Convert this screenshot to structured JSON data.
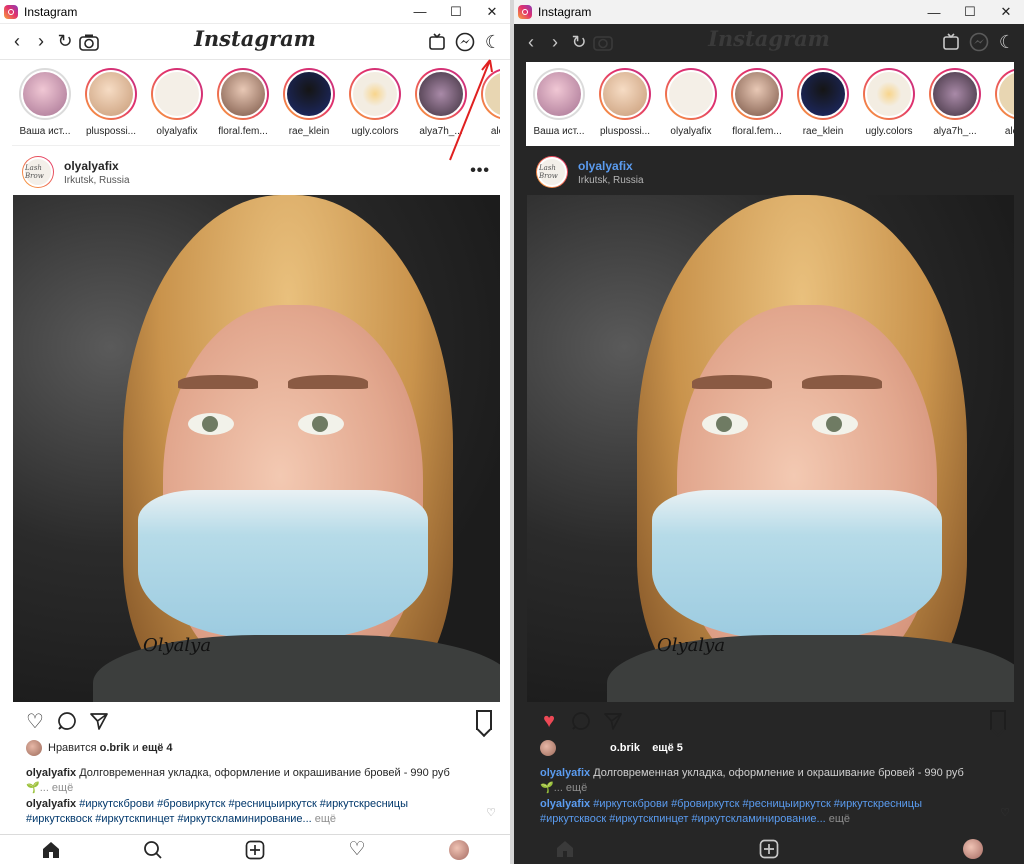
{
  "window": {
    "title": "Instagram",
    "min": "—",
    "max": "☐",
    "close": "✕"
  },
  "toolbar": {
    "brand": "Instagram"
  },
  "stories": [
    {
      "name": "Ваша ист...",
      "color": "#c6a0b5"
    },
    {
      "name": "pluspossi...",
      "color": "#e9cdb4"
    },
    {
      "name": "olyalyafix",
      "color": "#f4efe7"
    },
    {
      "name": "floral.fem...",
      "color": "#b98d74"
    },
    {
      "name": "rae_klein",
      "color": "#1d2b6e"
    },
    {
      "name": "ugly.colors",
      "color": "#f3ede2"
    },
    {
      "name": "alya7h_...",
      "color": "#5e4a5c"
    },
    {
      "name": "alexa...",
      "color": "#e8d6b2"
    }
  ],
  "post": {
    "user": "olyalyafix",
    "location": "Irkutsk, Russia",
    "avatar_text": "Lash Brow",
    "more": "•••",
    "signature": "Olyalya"
  },
  "likes_left": {
    "prefix": "Нравится",
    "user": "o.brik",
    "conj": "и",
    "count": "ещё 4"
  },
  "likes_right": {
    "user": "o.brik",
    "count": "ещё 5"
  },
  "caption": {
    "user": "olyalyafix",
    "text": "Долговременная укладка, оформление и окрашивание бровей - 990 руб",
    "emoji": "🌱",
    "more": "... ещё",
    "tag_user": "olyalyafix",
    "tags_line1": "#иркутскброви #бровиркутск #ресницыиркутск #иркутскресницы",
    "tags_line2": "#иркутсквоск #иркутскпинцет #иркутскламинирование...",
    "tags_more": "ещё"
  },
  "colors": {
    "accent": "#e1306c",
    "like": "#ed4956",
    "link_dark": "#5b9cf0",
    "dark_bg": "#262626"
  }
}
